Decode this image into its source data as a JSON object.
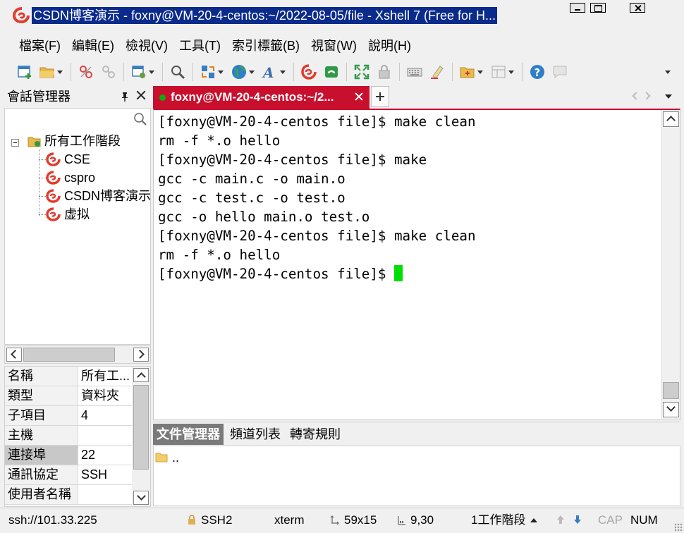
{
  "window": {
    "title": "CSDN博客演示 - foxny@VM-20-4-centos:~/2022-08-05/file - Xshell 7 (Free for H..."
  },
  "menu": [
    "檔案(F)",
    "編輯(E)",
    "檢視(V)",
    "工具(T)",
    "索引標籤(B)",
    "視窗(W)",
    "說明(H)"
  ],
  "session_manager": {
    "title": "會話管理器",
    "tree": {
      "root": "所有工作階段",
      "children": [
        "CSE",
        "cspro",
        "CSDN博客演示",
        "虚拟"
      ]
    },
    "properties": [
      {
        "key": "名稱",
        "value": "所有工..."
      },
      {
        "key": "類型",
        "value": "資料夾"
      },
      {
        "key": "子項目",
        "value": "4"
      },
      {
        "key": "主機",
        "value": ""
      },
      {
        "key": "連接埠",
        "value": "22"
      },
      {
        "key": "通訊協定",
        "value": "SSH"
      },
      {
        "key": "使用者名稱",
        "value": ""
      }
    ]
  },
  "tab": {
    "label": "foxny@VM-20-4-centos:~/2...",
    "status_color": "#22aa22",
    "accent": "#c8102e"
  },
  "terminal": {
    "lines": [
      "[foxny@VM-20-4-centos file]$ make clean",
      "rm -f *.o hello",
      "[foxny@VM-20-4-centos file]$ make",
      "gcc -c main.c -o main.o",
      "gcc -c test.c -o test.o",
      "gcc -o hello main.o test.o",
      "[foxny@VM-20-4-centos file]$ make clean",
      "rm -f *.o hello",
      "[foxny@VM-20-4-centos file]$ "
    ],
    "cursor_color": "#00e000"
  },
  "file_manager": {
    "tabs": [
      "文件管理器",
      "頻道列表",
      "轉寄規則"
    ],
    "items": [
      ".."
    ]
  },
  "statusbar": {
    "connection": "ssh://101.33.225",
    "protocol": "SSH2",
    "term_type": "xterm",
    "size": "59x15",
    "position": "9,30",
    "sessions": "1工作階段",
    "cap": "CAP",
    "num": "NUM"
  }
}
